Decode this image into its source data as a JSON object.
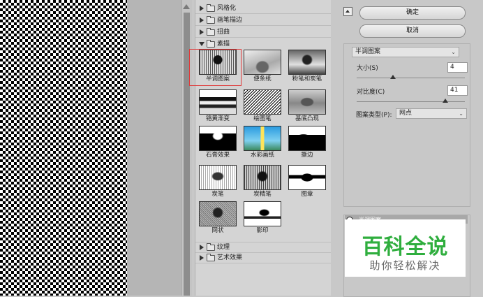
{
  "buttons": {
    "ok": "确定",
    "cancel": "取消"
  },
  "categories_top": [
    {
      "label": "风格化",
      "expanded": false
    },
    {
      "label": "画笔描边",
      "expanded": false
    },
    {
      "label": "扭曲",
      "expanded": false
    },
    {
      "label": "素描",
      "expanded": true
    }
  ],
  "sketch_filters": [
    {
      "label": "半调图案",
      "selected": true
    },
    {
      "label": "便条纸"
    },
    {
      "label": "粉笔和炭笔"
    },
    {
      "label": "铬黄渐变"
    },
    {
      "label": "绘图笔"
    },
    {
      "label": "基底凸现"
    },
    {
      "label": "石膏效果"
    },
    {
      "label": "水彩画纸"
    },
    {
      "label": "撕边"
    },
    {
      "label": "炭笔"
    },
    {
      "label": "炭精笔"
    },
    {
      "label": "图章"
    },
    {
      "label": "网状"
    },
    {
      "label": "影印"
    }
  ],
  "categories_bottom": [
    {
      "label": "纹理",
      "expanded": false
    },
    {
      "label": "艺术效果",
      "expanded": false
    }
  ],
  "options": {
    "filter_select": "半调图案",
    "size_label": "大小(S)",
    "size_value": "4",
    "size_max": 12,
    "contrast_label": "对比度(C)",
    "contrast_value": "41",
    "contrast_max": 50,
    "pattern_type_label": "图案类型(P):",
    "pattern_type_value": "网点"
  },
  "layers": {
    "layer_name": "半调图案"
  },
  "watermark": {
    "title": "百科全说",
    "subtitle": "助你轻松解决"
  },
  "colors": {
    "selection": "#e03a3a",
    "watermark_green": "#2fae3e"
  }
}
